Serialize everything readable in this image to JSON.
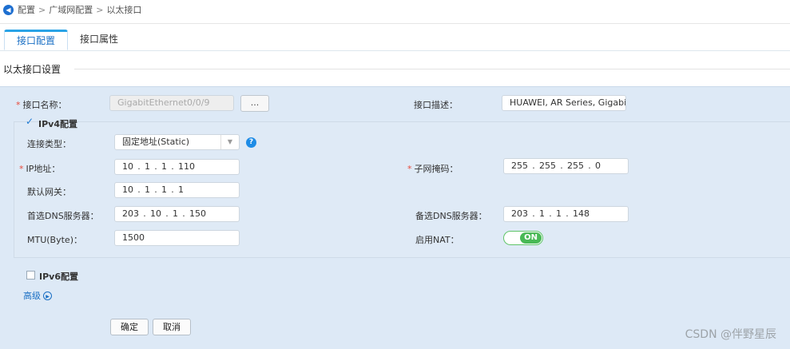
{
  "breadcrumb": {
    "items": [
      "配置",
      "广域网配置",
      "以太接口"
    ],
    "separator": ">"
  },
  "tabs": [
    {
      "label": "接口配置",
      "active": true
    },
    {
      "label": "接口属性",
      "active": false
    }
  ],
  "section_title": "以太接口设置",
  "form": {
    "interface_name_label": "接口名称：",
    "interface_name_value": "GigabitEthernet0/0/9",
    "browse_button": "...",
    "interface_desc_label": "接口描述：",
    "interface_desc_value": "HUAWEI, AR Series, GigabitE",
    "ipv4_label": "IPv4配置",
    "ipv4_checked": true,
    "conn_type_label": "连接类型：",
    "conn_type_value": "固定地址(Static)",
    "ip_label": "IP地址：",
    "ip_octets": [
      "10",
      "1",
      "1",
      "110"
    ],
    "mask_label": "子网掩码：",
    "mask_octets": [
      "255",
      "255",
      "255",
      "0"
    ],
    "gateway_label": "默认网关：",
    "gateway_octets": [
      "10",
      "1",
      "1",
      "1"
    ],
    "dns1_label": "首选DNS服务器：",
    "dns1_octets": [
      "203",
      "10",
      "1",
      "150"
    ],
    "dns2_label": "备选DNS服务器：",
    "dns2_octets": [
      "203",
      "1",
      "1",
      "148"
    ],
    "mtu_label": "MTU(Byte)：",
    "mtu_value": "1500",
    "nat_label": "启用NAT：",
    "nat_state": "ON",
    "ipv6_label": "IPv6配置",
    "ipv6_checked": false,
    "advanced_label": "高级"
  },
  "buttons": {
    "ok": "确定",
    "cancel": "取消"
  },
  "watermark": "CSDN @伴野星辰",
  "colors": {
    "accent": "#1a6fc4",
    "panel_bg": "#dde9f6",
    "toggle_on": "#49b956",
    "required": "#e84b3c"
  }
}
